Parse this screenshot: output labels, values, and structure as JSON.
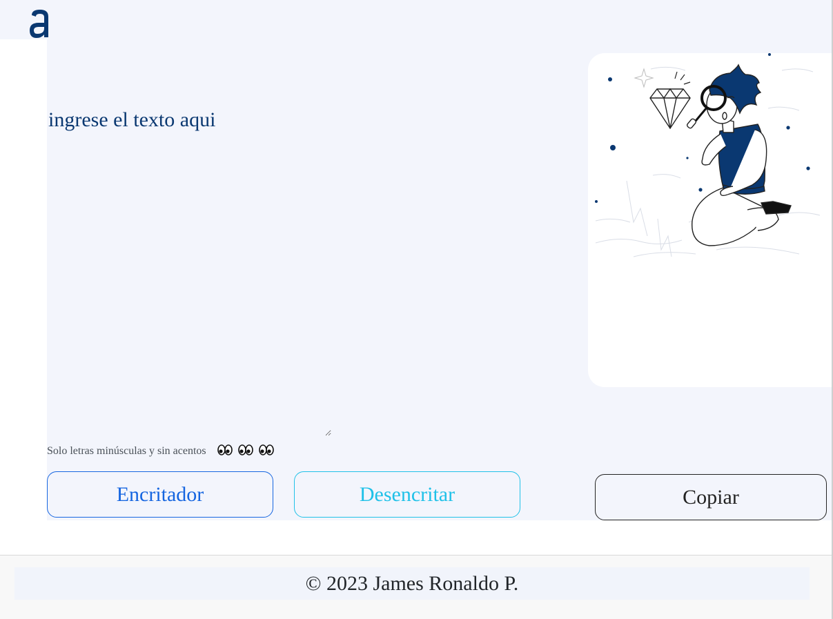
{
  "header": {
    "logo_icon": "alura-a-logo-icon",
    "logo_color": "#0a3871"
  },
  "input": {
    "placeholder": "ingrese el texto aqui",
    "value": ""
  },
  "hint": {
    "text": "Solo letras minúsculas y sin acentos",
    "icons": [
      "eyes-icon",
      "eyes-icon",
      "eyes-icon"
    ]
  },
  "buttons": {
    "encrypt_label": "Encritador",
    "decrypt_label": "Desencritar",
    "copy_label": "Copiar"
  },
  "output": {
    "illustration_icon": "person-searching-diamond-illustration"
  },
  "footer": {
    "text": "© 2023 James Ronaldo P."
  },
  "colors": {
    "primary": "#0a3871",
    "encrypt": "#1565e0",
    "decrypt": "#1fc1e8",
    "panel_bg": "#f3f5fc"
  }
}
